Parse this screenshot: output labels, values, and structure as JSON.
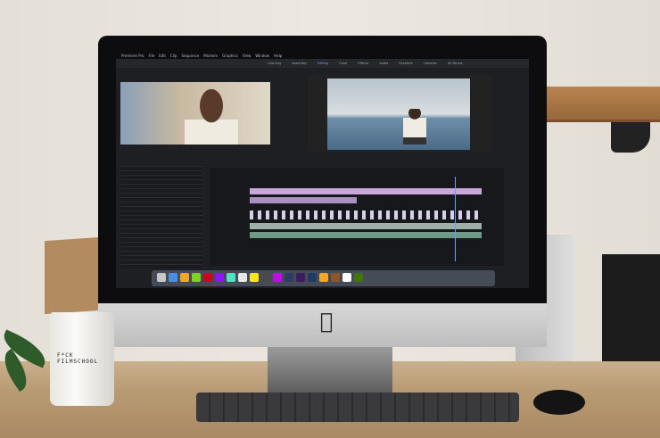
{
  "scene": "desk-setup",
  "screen": {
    "menubar": [
      "Premiere Pro",
      "File",
      "Edit",
      "Clip",
      "Sequence",
      "Markers",
      "Graphics",
      "View",
      "Window",
      "Help"
    ],
    "workspaces": [
      "Learning",
      "Assembly",
      "Editing",
      "Color",
      "Effects",
      "Audio",
      "Graphics",
      "Libraries",
      "All Panels"
    ],
    "active_workspace": "Editing",
    "dock_icon_colors": [
      "#c9c9c9",
      "#4a90e2",
      "#f5a623",
      "#7ed321",
      "#d0021b",
      "#9013fe",
      "#50e3c2",
      "#e8e8e8",
      "#f8e71c",
      "#4a4a4a",
      "#bd10e0",
      "#2f3d66",
      "#3b1d5c",
      "#1e3b66",
      "#f5a623",
      "#8b572a",
      "#ffffff",
      "#417505"
    ]
  },
  "mug": {
    "logo_text": "F*CK FILMSCHOOL"
  },
  "colors": {
    "wall": "#e8e4dc",
    "desk": "#b89a73",
    "bezel": "#0d0d0f",
    "clip_purple": "#c8a8d8",
    "clip_green": "#7fa890"
  }
}
